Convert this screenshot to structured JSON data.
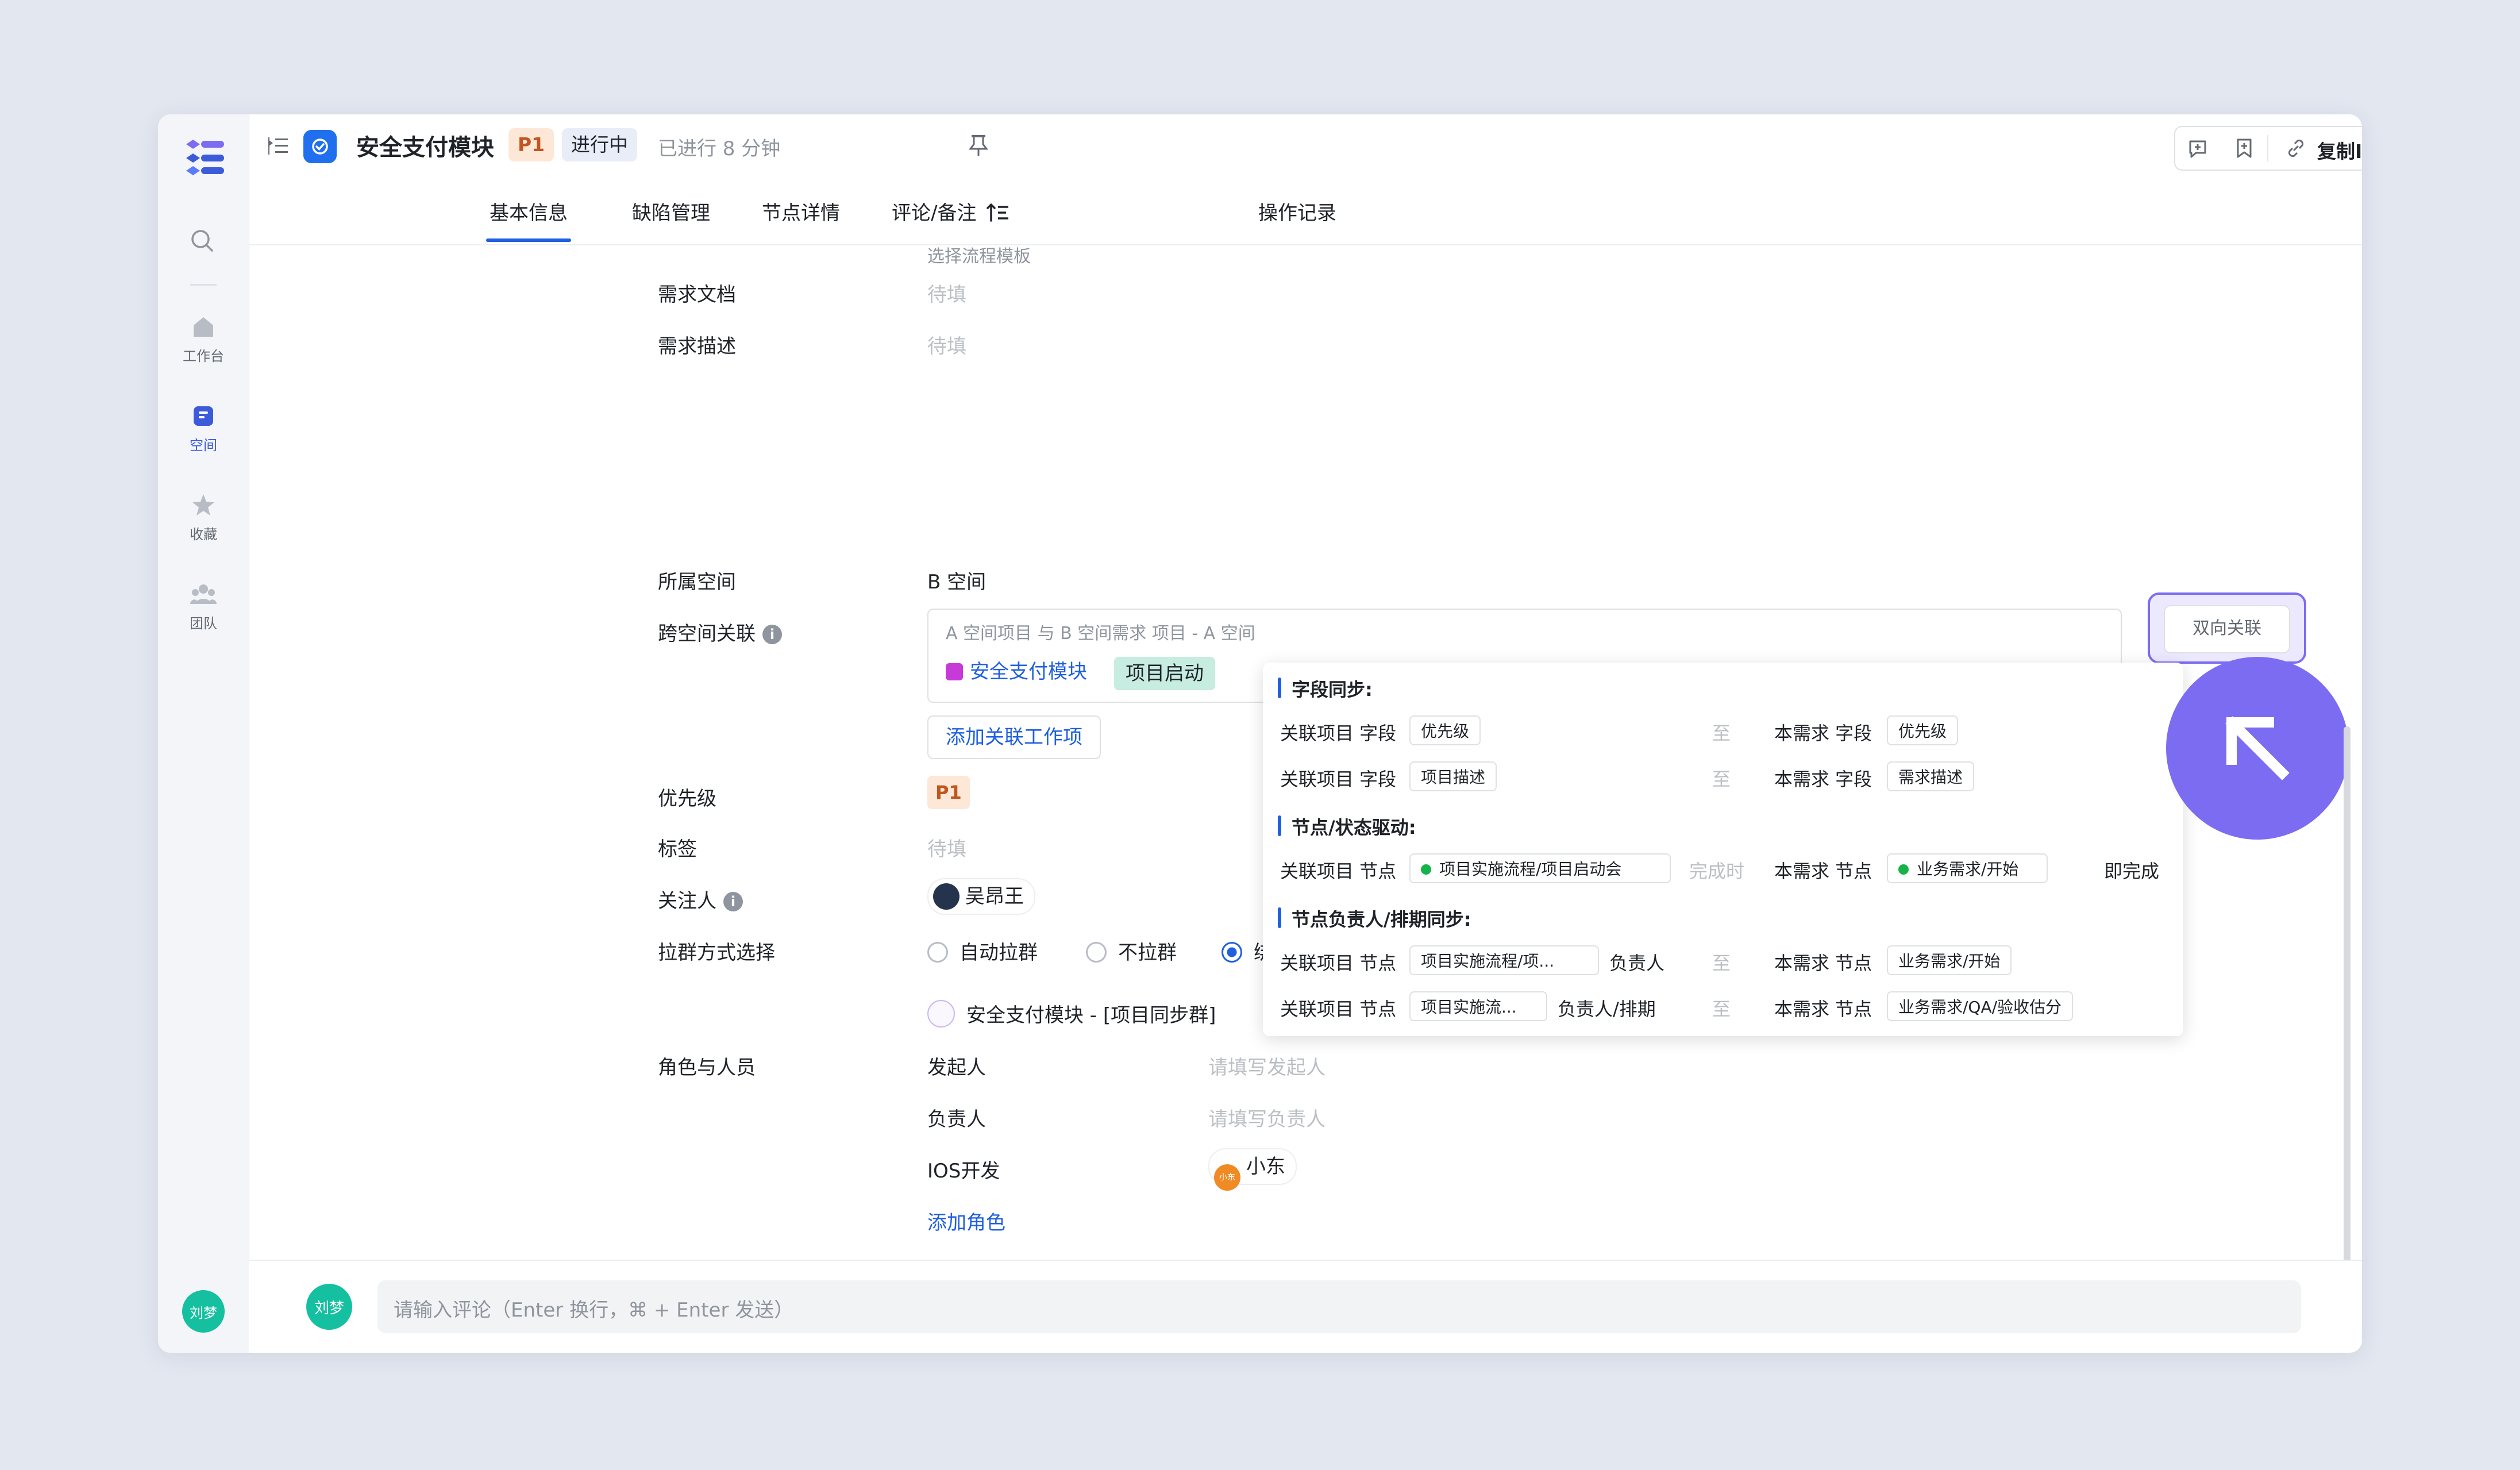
{
  "sidebar": {
    "items": [
      {
        "label": "工作台",
        "icon": "home-icon"
      },
      {
        "label": "空间",
        "icon": "space-icon"
      },
      {
        "label": "收藏",
        "icon": "star-icon"
      },
      {
        "label": "团队",
        "icon": "team-icon"
      }
    ],
    "user_avatar": "刘梦"
  },
  "header": {
    "title": "安全支付模块",
    "priority": "P1",
    "status": "进行中",
    "elapsed": "已进行 8 分钟",
    "copy_id": "复制ID"
  },
  "tabs": [
    {
      "label": "基本信息",
      "active": true
    },
    {
      "label": "缺陷管理"
    },
    {
      "label": "节点详情"
    },
    {
      "label": "评论/备注"
    },
    {
      "label": "操作记录"
    }
  ],
  "form": {
    "flow_template_hint": "选择流程模板",
    "doc_label": "需求文档",
    "doc_value": "待填",
    "desc_label": "需求描述",
    "desc_value": "待填",
    "space_label": "所属空间",
    "space_value": "B 空间",
    "cross_label": "跨空间关联",
    "cross_hint": "A 空间项目 与 B 空间需求  项目 - A 空间",
    "cross_work_item": "安全支付模块",
    "cross_node": "项目启动",
    "add_rel": "添加关联工作项",
    "bidir": "双向关联",
    "priority_label": "优先级",
    "priority_value": "P1",
    "tag_label": "标签",
    "tag_value": "待填",
    "watcher_label": "关注人",
    "watcher_value": "吴昂王",
    "group_label": "拉群方式选择",
    "group_options": [
      "自动拉群",
      "不拉群",
      "绑定"
    ],
    "group_selected": "绑定",
    "group_name": "安全支付模块 - [项目同步群]",
    "roles_label": "角色与人员",
    "roles": [
      {
        "role": "发起人",
        "placeholder": "请填写发起人"
      },
      {
        "role": "负责人",
        "placeholder": "请填写负责人"
      },
      {
        "role": "IOS开发",
        "person": "小东",
        "avatar": "小东"
      }
    ],
    "add_role": "添加角色"
  },
  "popover": {
    "sec1": "字段同步:",
    "sec2": "节点/状态驱动:",
    "sec3": "节点负责人/排期同步:",
    "rows_field": [
      {
        "left": "关联项目 字段",
        "left_tag": "优先级",
        "to": "至",
        "right": "本需求 字段",
        "right_tag": "优先级"
      },
      {
        "left": "关联项目 字段",
        "left_tag": "项目描述",
        "to": "至",
        "right": "本需求 字段",
        "right_tag": "需求描述"
      }
    ],
    "row_node": {
      "left": "关联项目 节点",
      "left_tag": "项目实施流程/项目启动会",
      "when": "完成时",
      "right": "本需求 节点",
      "right_tag": "业务需求/开始",
      "action": "即完成"
    },
    "rows_owner": [
      {
        "left": "关联项目 节点",
        "left_tag": "项目实施流程/项...",
        "what": "负责人",
        "to": "至",
        "right": "本需求 节点",
        "right_tag": "业务需求/开始"
      },
      {
        "left": "关联项目 节点",
        "left_tag": "项目实施流...",
        "what": "负责人/排期",
        "to": "至",
        "right": "本需求 节点",
        "right_tag": "业务需求/QA/验收估分"
      }
    ]
  },
  "footer": {
    "avatar": "刘梦",
    "comment_placeholder": "请输入评论（Enter 换行，⌘ + Enter 发送）"
  },
  "colors": {
    "accent": "#1f5fe0",
    "cursor": "#7c6cf2",
    "priority_bg": "#fde7d7",
    "node_chip_bg": "#c7ece0"
  }
}
